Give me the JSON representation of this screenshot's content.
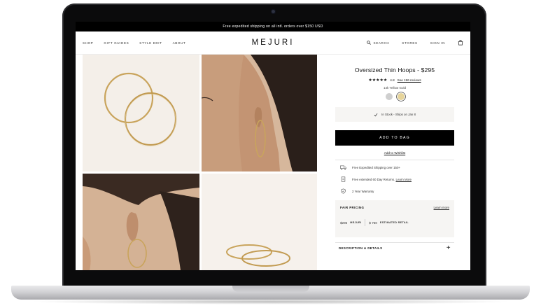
{
  "promo": {
    "text": "Free expedited shipping on all intl. orders over $150 USD"
  },
  "nav": {
    "left": [
      "SHOP",
      "GIFT GUIDES",
      "STYLE EDIT",
      "ABOUT"
    ],
    "logo": "MEJURI",
    "search": "SEARCH",
    "stores": "STORES",
    "signin": "SIGN IN"
  },
  "product": {
    "title": "Oversized Thin Hoops - $295",
    "rating": "4.8",
    "stars": "★★★★★",
    "reviews": "See 196 reviews",
    "material": "14k Yellow Gold",
    "swatches": [
      {
        "name": "silver",
        "color": "#cfcfcf"
      },
      {
        "name": "yellow-gold",
        "color": "#e6d49a",
        "selected": true
      }
    ],
    "stock": "In Stock - Ships on Jan 8",
    "add_to_bag": "ADD TO BAG",
    "wishlist": "Add to Wishlist"
  },
  "perks": {
    "shipping": "Free Expedited Shipping over 150+",
    "returns": "Free extended 60 Day Returns.",
    "returns_link": "Learn More",
    "warranty": "2 Year Warranty"
  },
  "pricing": {
    "title": "FAIR PRICING",
    "learn_more": "Learn more",
    "mejuri_price": "$295",
    "mejuri_label": "MEJURI",
    "retail_price": "$ 750",
    "retail_label": "ESTIMATED RETAIL"
  },
  "details": {
    "label": "DESCRIPTION & DETAILS",
    "toggle": "+"
  },
  "colors": {
    "accent": "#000000",
    "panel_bg": "#f6f5f3",
    "gold": "#c8a45a"
  }
}
